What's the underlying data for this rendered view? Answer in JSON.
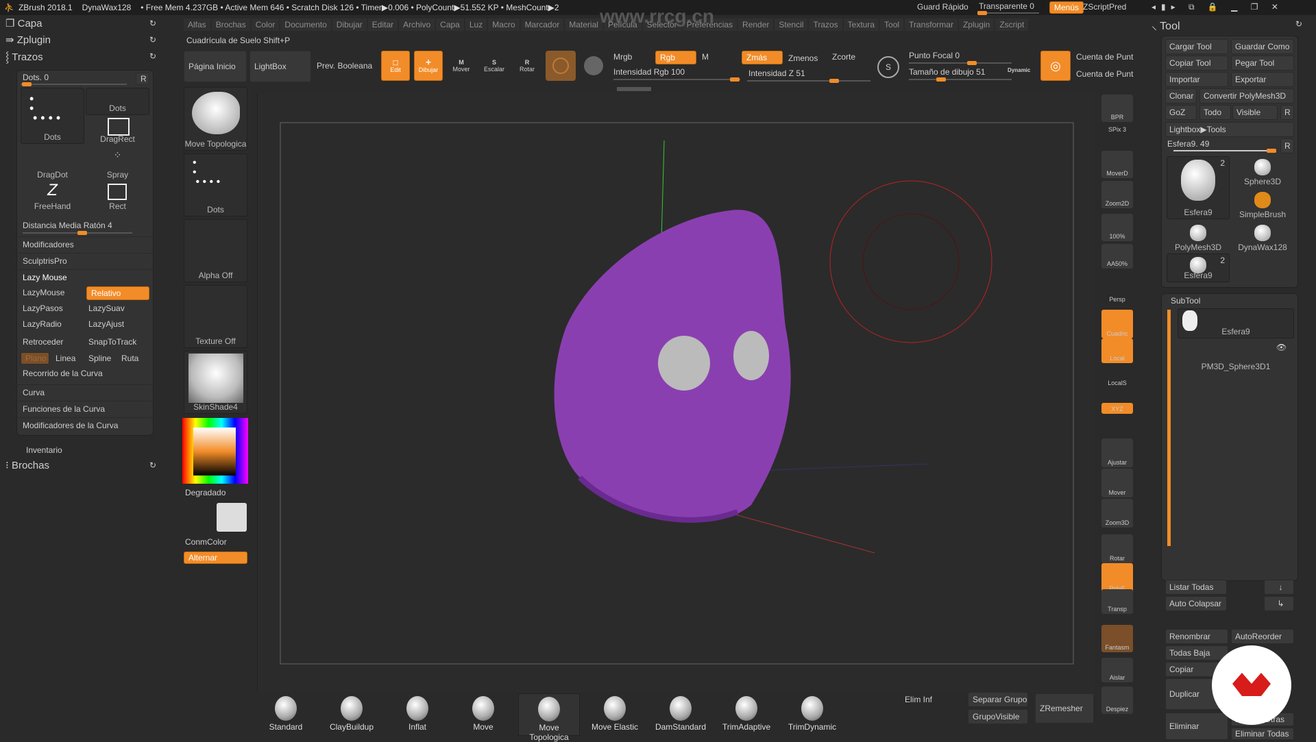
{
  "titlebar": {
    "app": "ZBrush 2018.1",
    "tool": "DynaWax128",
    "stats": "• Free Mem 4.237GB • Active Mem 646 • Scratch Disk 126 •  Timer▶0.006 • PolyCount▶51.552 KP  • MeshCount▶2",
    "quick_save": "Guard Rápido",
    "transparent": "Transparente 0",
    "transparent_value": 0,
    "menus": "Menús",
    "script": "ZScriptPred"
  },
  "menu": [
    "Alfas",
    "Brochas",
    "Color",
    "Documento",
    "Dibujar",
    "Editar",
    "Archivo",
    "Capa",
    "Luz",
    "Macro",
    "Marcador",
    "Material",
    "Película",
    "Selector",
    "Preferencias",
    "Render",
    "Stencil",
    "Trazos",
    "Textura",
    "Tool",
    "Transformar",
    "Zplugin",
    "Zscript"
  ],
  "hint": "Cuadrícula de Suelo Shift+P",
  "toolbar": {
    "home": "Página Inicio",
    "lightbox": "LightBox",
    "boolean": "Prev. Booleana",
    "edit": "Edit",
    "draw": "Dibujar",
    "move": "Mover",
    "scale": "Escalar",
    "rotate": "Rotar",
    "mrgb": "Mrgb",
    "rgb": "Rgb",
    "m": "M",
    "rgb_intensity": "Intensidad Rgb 100",
    "zadd": "Zmás",
    "zsub": "Zmenos",
    "zcut": "Zcorte",
    "z_intensity": "Intensidad Z 51",
    "focal": "Punto Focal 0",
    "draw_size": "Tamaño de dibujo 51",
    "dynamic": "Dynamic",
    "point_count1": "Cuenta de Punt",
    "point_count2": "Cuenta de Punt"
  },
  "left": {
    "palettes": [
      "Capa",
      "Zplugin",
      "Trazos"
    ],
    "dots": "Dots. 0",
    "r": "R",
    "strokes": [
      "Dots",
      "Dots",
      "DragRect",
      "DragDot",
      "Spray",
      "FreeHand",
      "Rect"
    ],
    "mouse_avg": "Distancia Media Ratón 4",
    "sections": [
      "Modificadores",
      "SculptrisPro",
      "Lazy Mouse"
    ],
    "lazymouse": "LazyMouse",
    "relative": "Relativo",
    "lazy": [
      "LazyPasos",
      "LazySuav",
      "LazyRadio",
      "LazyAjust",
      "Retroceder",
      "SnapToTrack"
    ],
    "modes": [
      "Plano",
      "Linea",
      "Spline",
      "Ruta"
    ],
    "curve_step": "Recorrido de la Curva",
    "curve_sections": [
      "Curva",
      "Funciones de la Curva",
      "Modificadores de la Curva"
    ],
    "inventory": "Inventario",
    "brushes": "Brochas"
  },
  "brushcol": {
    "items": [
      "Move Topologica",
      "Dots",
      "Alpha Off",
      "Texture Off",
      "SkinShade4"
    ],
    "gradient": "Degradado",
    "main_color": "ConmColor",
    "switch": "Alternar"
  },
  "rshelf": [
    "BPR",
    "SPix 3",
    "MoverD",
    "Zoom2D",
    "100%",
    "AA50%",
    "Persp",
    "Cuadric",
    "Local",
    "LocalS",
    "XYZ",
    "Ajustar",
    "Mover",
    "Zoom3D",
    "Rotar",
    "PolyF",
    "Transp",
    "Fantasm",
    "Aislar",
    "Despiez"
  ],
  "tool": {
    "title": "Tool",
    "buttons": [
      "Cargar Tool",
      "Guardar Como",
      "Copiar Tool",
      "Pegar Tool",
      "Importar",
      "Exportar",
      "Clonar",
      "Convertir PolyMesh3D",
      "GoZ",
      "Todo",
      "Visible",
      "R"
    ],
    "lightbox": "Lightbox▶Tools",
    "current": "Esfera9. 49",
    "tools": [
      "Esfera9",
      "Sphere3D",
      "SimpleBrush",
      "PolyMesh3D",
      "DynaWax128",
      "Esfera9"
    ],
    "badge": "2",
    "subtool": "SubTool",
    "subtools": [
      "Esfera9",
      "PM3D_Sphere3D1"
    ],
    "list_all": "Listar Todas",
    "auto_collapse": "Auto Colapsar",
    "actions": [
      "Renombrar",
      "AutoReorder",
      "Todas Baja",
      "Copiar",
      "Duplicar",
      "Eliminar",
      "Elimina Otras",
      "Eliminar Todas"
    ]
  },
  "bottom": {
    "brushes": [
      "Standard",
      "ClayBuildup",
      "Inflat",
      "Move",
      "Move Topologica",
      "Move Elastic",
      "DamStandard",
      "TrimAdaptive",
      "TrimDynamic"
    ],
    "del_lower": "Elim Inf",
    "split": "Separar Grupo",
    "group_visible": "GrupoVisible",
    "zremesher": "ZRemesher"
  },
  "watermark": "www.rrcg.cn",
  "colors": {
    "accent": "#f28c28",
    "mesh": "#8a3fb0",
    "bg": "#2a2a2a"
  }
}
